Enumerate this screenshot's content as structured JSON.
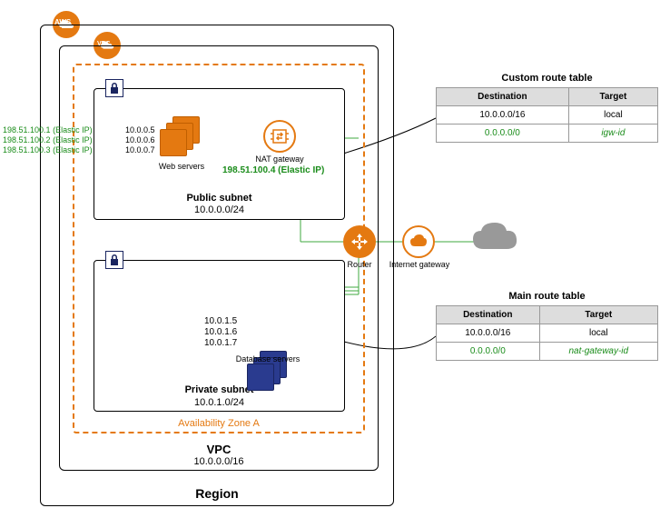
{
  "badges": {
    "aws": "AWS",
    "vpc": "VPC"
  },
  "region": {
    "label": "Region"
  },
  "vpc": {
    "label": "VPC",
    "cidr": "10.0.0.0/16"
  },
  "az": {
    "label": "Availability Zone A"
  },
  "public_subnet": {
    "label": "Public subnet",
    "cidr": "10.0.0.0/24",
    "web_servers_label": "Web servers",
    "ips": [
      "10.0.0.5",
      "10.0.0.6",
      "10.0.0.7"
    ],
    "elastic_ips": [
      {
        "ip": "198.51.100.1",
        "tag": "(Elastic IP)"
      },
      {
        "ip": "198.51.100.2",
        "tag": "(Elastic IP)"
      },
      {
        "ip": "198.51.100.3",
        "tag": "(Elastic IP)"
      }
    ],
    "nat_label": "NAT gateway",
    "nat_eip": {
      "ip": "198.51.100.4",
      "tag": "(Elastic IP)"
    }
  },
  "private_subnet": {
    "label": "Private  subnet",
    "cidr": "10.0.1.0/24",
    "db_servers_label": "Database servers",
    "ips": [
      "10.0.1.5",
      "10.0.1.6",
      "10.0.1.7"
    ]
  },
  "router": {
    "label": "Router"
  },
  "igw": {
    "label": "Internet gateway"
  },
  "custom_route_table": {
    "title": "Custom route table",
    "headers": [
      "Destination",
      "Target"
    ],
    "rows": [
      {
        "dest": "10.0.0.0/16",
        "target": "local",
        "green": false
      },
      {
        "dest": "0.0.0.0/0",
        "target": "igw-id",
        "green": true
      }
    ]
  },
  "main_route_table": {
    "title": "Main route table",
    "headers": [
      "Destination",
      "Target"
    ],
    "rows": [
      {
        "dest": "10.0.0.0/16",
        "target": "local",
        "green": false
      },
      {
        "dest": "0.0.0.0/0",
        "target": "nat-gateway-id",
        "green": true
      }
    ]
  },
  "icons": {
    "lock": "lock-icon",
    "nat": "nat-gateway-icon",
    "router": "router-icon",
    "igw": "internet-gateway-icon",
    "cloud": "internet-cloud-icon"
  }
}
